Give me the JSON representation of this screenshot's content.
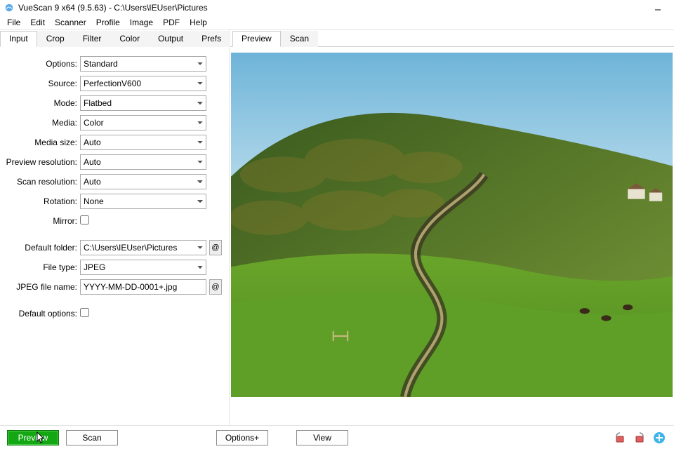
{
  "window": {
    "title": "VueScan 9 x64 (9.5.63) - C:\\Users\\IEUser\\Pictures"
  },
  "menu": [
    "File",
    "Edit",
    "Scanner",
    "Profile",
    "Image",
    "PDF",
    "Help"
  ],
  "left_tabs": [
    "Input",
    "Crop",
    "Filter",
    "Color",
    "Output",
    "Prefs"
  ],
  "left_tab_active": 0,
  "right_tabs": [
    "Preview",
    "Scan"
  ],
  "right_tab_active": 0,
  "form": {
    "options": {
      "label": "Options:",
      "value": "Standard"
    },
    "source": {
      "label": "Source:",
      "value": "PerfectionV600"
    },
    "mode": {
      "label": "Mode:",
      "value": "Flatbed"
    },
    "media": {
      "label": "Media:",
      "value": "Color"
    },
    "media_size": {
      "label": "Media size:",
      "value": "Auto"
    },
    "preview_res": {
      "label": "Preview resolution:",
      "value": "Auto"
    },
    "scan_res": {
      "label": "Scan resolution:",
      "value": "Auto"
    },
    "rotation": {
      "label": "Rotation:",
      "value": "None"
    },
    "mirror": {
      "label": "Mirror:",
      "checked": false
    },
    "default_folder": {
      "label": "Default folder:",
      "value": "C:\\Users\\IEUser\\Pictures"
    },
    "file_type": {
      "label": "File type:",
      "value": "JPEG"
    },
    "jpeg_name": {
      "label": "JPEG file name:",
      "value": "YYYY-MM-DD-0001+.jpg"
    },
    "default_options": {
      "label": "Default options:",
      "checked": false
    }
  },
  "buttons": {
    "preview": "Preview",
    "scan": "Scan",
    "options_plus": "Options+",
    "view": "View"
  },
  "icons": {
    "at": "@",
    "rotate_left": "rotate-left",
    "rotate_right": "rotate-right",
    "add": "add"
  }
}
